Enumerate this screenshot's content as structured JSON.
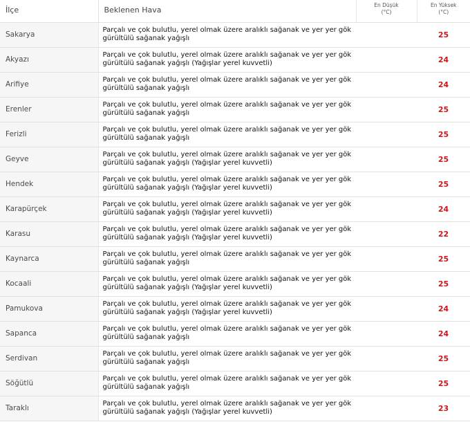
{
  "headers": {
    "district": "İlçe",
    "forecast": "Beklenen Hava",
    "min_line1": "En Düşük",
    "min_line2": "(°C)",
    "max_line1": "En Yüksek",
    "max_line2": "(°C)"
  },
  "rows": [
    {
      "district": "Sakarya",
      "forecast": "Parçalı ve çok bulutlu, yerel olmak üzere aralıklı sağanak ve yer yer gök gürültülü sağanak yağışlı",
      "min": "",
      "max": "25"
    },
    {
      "district": "Akyazı",
      "forecast": "Parçalı ve çok bulutlu, yerel olmak üzere aralıklı sağanak ve yer yer gök gürültülü sağanak yağışlı (Yağışlar yerel kuvvetli)",
      "min": "",
      "max": "24"
    },
    {
      "district": "Arifiye",
      "forecast": "Parçalı ve çok bulutlu, yerel olmak üzere aralıklı sağanak ve yer yer gök gürültülü sağanak yağışlı",
      "min": "",
      "max": "24"
    },
    {
      "district": "Erenler",
      "forecast": "Parçalı ve çok bulutlu, yerel olmak üzere aralıklı sağanak ve yer yer gök gürültülü sağanak yağışlı",
      "min": "",
      "max": "25"
    },
    {
      "district": "Ferizli",
      "forecast": "Parçalı ve çok bulutlu, yerel olmak üzere aralıklı sağanak ve yer yer gök gürültülü sağanak yağışlı",
      "min": "",
      "max": "25"
    },
    {
      "district": "Geyve",
      "forecast": "Parçalı ve çok bulutlu, yerel olmak üzere aralıklı sağanak ve yer yer gök gürültülü sağanak yağışlı (Yağışlar yerel kuvvetli)",
      "min": "",
      "max": "25"
    },
    {
      "district": "Hendek",
      "forecast": "Parçalı ve çok bulutlu, yerel olmak üzere aralıklı sağanak ve yer yer gök gürültülü sağanak yağışlı (Yağışlar yerel kuvvetli)",
      "min": "",
      "max": "25"
    },
    {
      "district": "Karapürçek",
      "forecast": "Parçalı ve çok bulutlu, yerel olmak üzere aralıklı sağanak ve yer yer gök gürültülü sağanak yağışlı (Yağışlar yerel kuvvetli)",
      "min": "",
      "max": "24"
    },
    {
      "district": "Karasu",
      "forecast": "Parçalı ve çok bulutlu, yerel olmak üzere aralıklı sağanak ve yer yer gök gürültülü sağanak yağışlı (Yağışlar yerel kuvvetli)",
      "min": "",
      "max": "22"
    },
    {
      "district": "Kaynarca",
      "forecast": "Parçalı ve çok bulutlu, yerel olmak üzere aralıklı sağanak ve yer yer gök gürültülü sağanak yağışlı",
      "min": "",
      "max": "25"
    },
    {
      "district": "Kocaali",
      "forecast": "Parçalı ve çok bulutlu, yerel olmak üzere aralıklı sağanak ve yer yer gök gürültülü sağanak yağışlı (Yağışlar yerel kuvvetli)",
      "min": "",
      "max": "25"
    },
    {
      "district": "Pamukova",
      "forecast": "Parçalı ve çok bulutlu, yerel olmak üzere aralıklı sağanak ve yer yer gök gürültülü sağanak yağışlı (Yağışlar yerel kuvvetli)",
      "min": "",
      "max": "24"
    },
    {
      "district": "Sapanca",
      "forecast": "Parçalı ve çok bulutlu, yerel olmak üzere aralıklı sağanak ve yer yer gök gürültülü sağanak yağışlı",
      "min": "",
      "max": "24"
    },
    {
      "district": "Serdivan",
      "forecast": "Parçalı ve çok bulutlu, yerel olmak üzere aralıklı sağanak ve yer yer gök gürültülü sağanak yağışlı",
      "min": "",
      "max": "25"
    },
    {
      "district": "Söğütlü",
      "forecast": "Parçalı ve çok bulutlu, yerel olmak üzere aralıklı sağanak ve yer yer gök gürültülü sağanak yağışlı",
      "min": "",
      "max": "25"
    },
    {
      "district": "Taraklı",
      "forecast": "Parçalı ve çok bulutlu, yerel olmak üzere aralıklı sağanak ve yer yer gök gürültülü sağanak yağışlı (Yağışlar yerel kuvvetli)",
      "min": "",
      "max": "23"
    }
  ]
}
